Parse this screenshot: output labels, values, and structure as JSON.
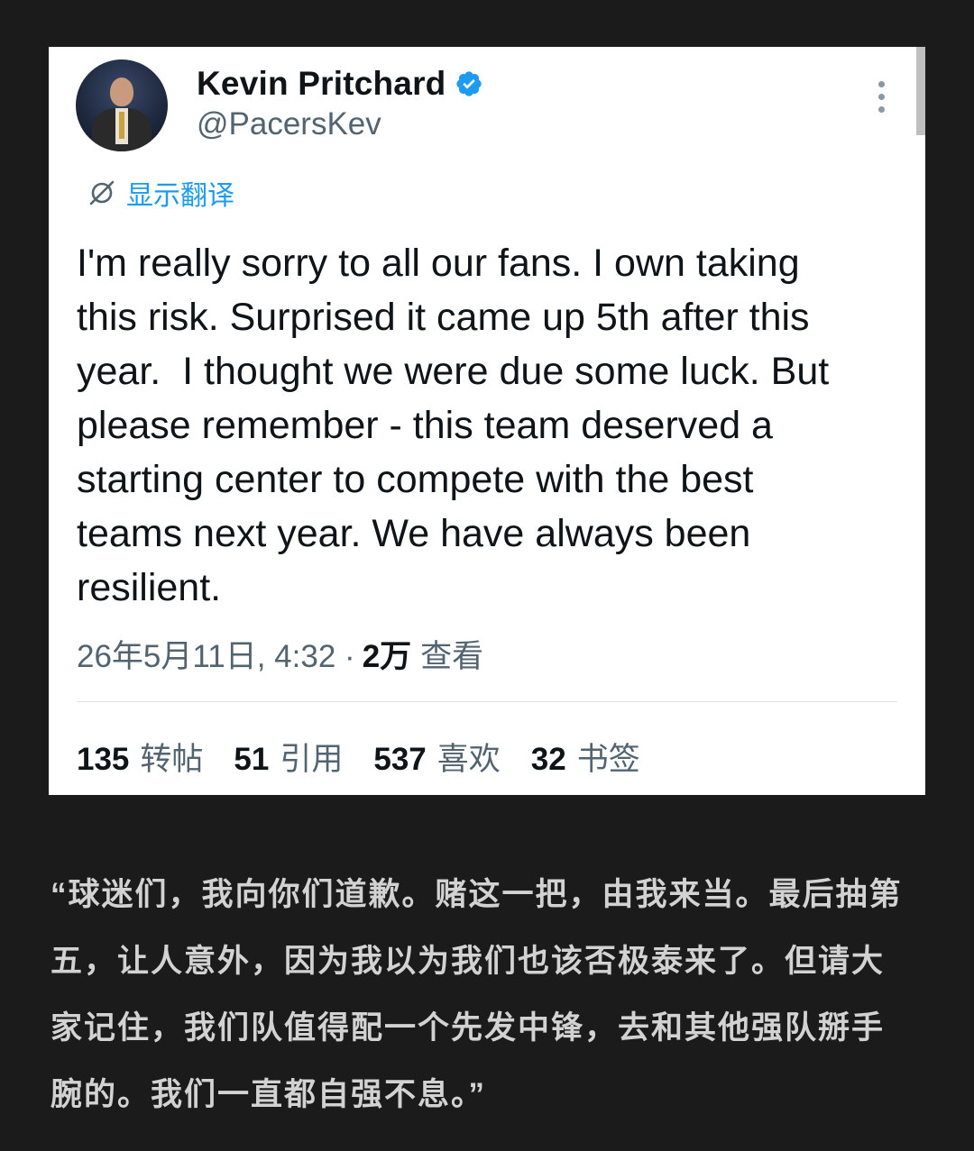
{
  "tweet": {
    "author_name": "Kevin Pritchard",
    "handle": "@PacersKev",
    "translate_label": "显示翻译",
    "text": "I'm really sorry to all our fans. I own taking\nthis risk. Surprised it came up 5th after this\nyear.  I thought we were due some luck. But\nplease remember - this team deserved a\nstarting center to compete with the best\nteams next year. We have always been\nresilient.",
    "timestamp": "26年5月11日, 4:32 ·",
    "views_count": "2万",
    "views_label": "查看",
    "stats": [
      {
        "count": "135",
        "label": "转帖"
      },
      {
        "count": "51",
        "label": "引用"
      },
      {
        "count": "537",
        "label": "喜欢"
      },
      {
        "count": "32",
        "label": "书签"
      }
    ],
    "colors": {
      "accent": "#1d9bf0",
      "secondary_text": "#536471",
      "primary_text": "#0f1419"
    }
  },
  "caption": {
    "text": "“球迷们，我向你们道歉。赌这一把，由我来当。最后抽第\n五，让人意外，因为我以为我们也该否极泰来了。但请大\n家记住，我们队值得配一个先发中锋，去和其他强队掰手\n腕的。我们一直都自强不息。”"
  },
  "icons": {
    "verified": "verified-badge-icon",
    "more": "more-vertical-icon",
    "translate": "globe-slash-icon"
  }
}
